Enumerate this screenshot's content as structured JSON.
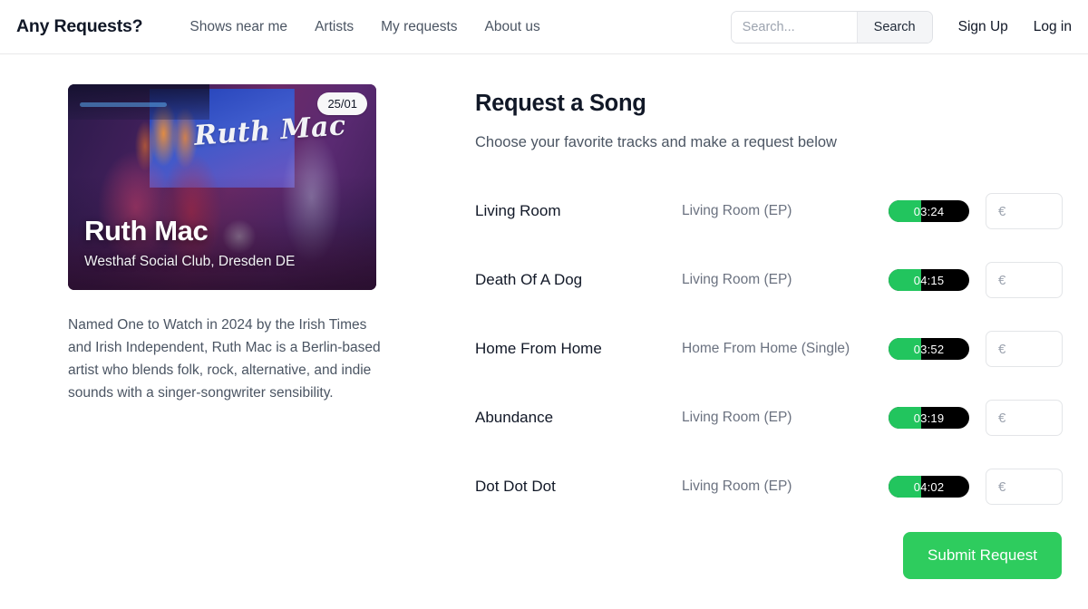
{
  "header": {
    "brand": "Any Requests?",
    "nav": [
      {
        "label": "Shows near me"
      },
      {
        "label": "Artists"
      },
      {
        "label": "My requests"
      },
      {
        "label": "About us"
      }
    ],
    "search": {
      "placeholder": "Search...",
      "value": "",
      "button_label": "Search"
    },
    "auth": [
      {
        "label": "Sign Up"
      },
      {
        "label": "Log in"
      }
    ]
  },
  "event": {
    "date_badge": "25/01",
    "artist": "Ruth Mac",
    "screen_logo": "Ruth Mac",
    "venue": "Westhaf Social Club, Dresden DE",
    "bio": "Named One to Watch in 2024 by the Irish Times and Irish Independent, Ruth Mac is a Berlin-based artist who blends folk, rock, alternative, and indie sounds with a singer-songwriter sensibility."
  },
  "request": {
    "title": "Request a Song",
    "subtitle": "Choose your favorite tracks and make a request below",
    "price_placeholder": "€",
    "submit_label": "Submit Request",
    "progress_percent": 40,
    "accent_green": "#22c55e",
    "submit_green": "#2ecc5e",
    "tracks": [
      {
        "name": "Living Room",
        "album": "Living Room (EP)",
        "duration": "03:24",
        "price": ""
      },
      {
        "name": "Death Of A Dog",
        "album": "Living Room (EP)",
        "duration": "04:15",
        "price": ""
      },
      {
        "name": "Home From Home",
        "album": "Home From Home (Single)",
        "duration": "03:52",
        "price": ""
      },
      {
        "name": "Abundance",
        "album": "Living Room (EP)",
        "duration": "03:19",
        "price": ""
      },
      {
        "name": "Dot Dot Dot",
        "album": "Living Room (EP)",
        "duration": "04:02",
        "price": ""
      }
    ]
  }
}
